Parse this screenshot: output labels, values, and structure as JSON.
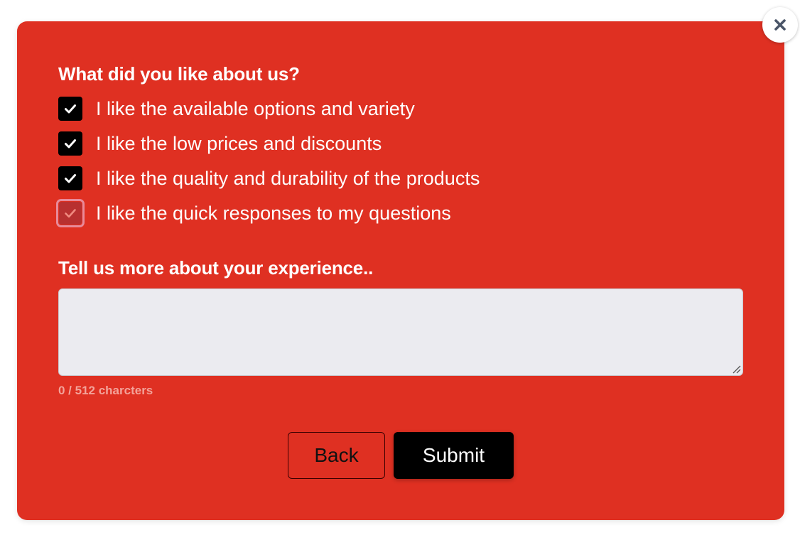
{
  "colors": {
    "card_background": "#df3022",
    "checkbox_checked": "#000000",
    "checkbox_focused_ring": "#e88a9a",
    "submit_background": "#000000",
    "textarea_background": "#ebebf0",
    "close_icon": "#4a5568"
  },
  "close": {
    "icon": "close-icon"
  },
  "survey": {
    "like_question": "What did you like about us?",
    "options": [
      {
        "label": "I like the available options and variety",
        "checked": true
      },
      {
        "label": "I like the low prices and discounts",
        "checked": true
      },
      {
        "label": "I like the quality and durability of the products",
        "checked": true
      },
      {
        "label": "I like the quick responses to my questions",
        "checked": true,
        "focused": true
      }
    ],
    "experience_question": "Tell us more about your experience..",
    "experience_value": "",
    "char_count": "0 / 512 charcters"
  },
  "actions": {
    "back_label": "Back",
    "submit_label": "Submit"
  }
}
